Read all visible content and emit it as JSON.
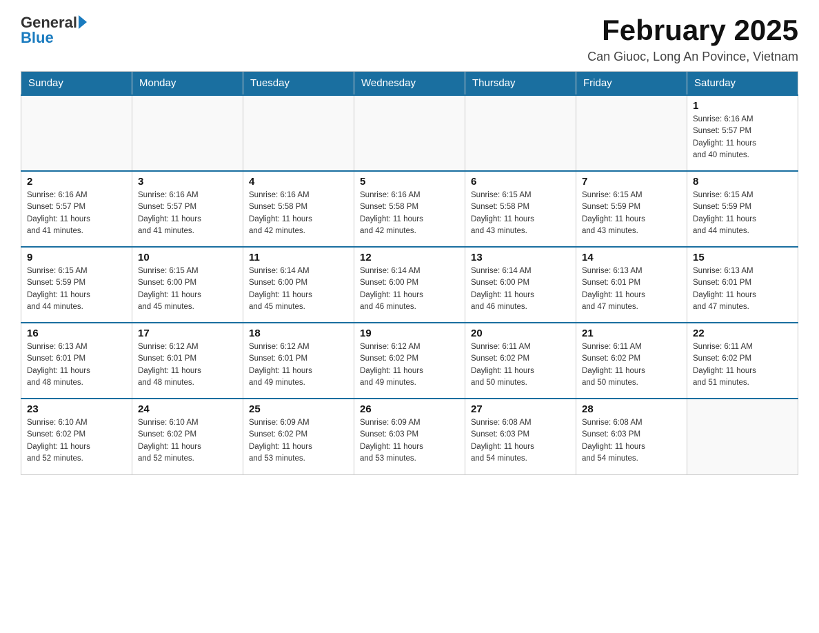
{
  "logo": {
    "general": "General",
    "blue": "Blue"
  },
  "title": "February 2025",
  "subtitle": "Can Giuoc, Long An Povince, Vietnam",
  "days_of_week": [
    "Sunday",
    "Monday",
    "Tuesday",
    "Wednesday",
    "Thursday",
    "Friday",
    "Saturday"
  ],
  "weeks": [
    [
      {
        "day": "",
        "info": ""
      },
      {
        "day": "",
        "info": ""
      },
      {
        "day": "",
        "info": ""
      },
      {
        "day": "",
        "info": ""
      },
      {
        "day": "",
        "info": ""
      },
      {
        "day": "",
        "info": ""
      },
      {
        "day": "1",
        "info": "Sunrise: 6:16 AM\nSunset: 5:57 PM\nDaylight: 11 hours\nand 40 minutes."
      }
    ],
    [
      {
        "day": "2",
        "info": "Sunrise: 6:16 AM\nSunset: 5:57 PM\nDaylight: 11 hours\nand 41 minutes."
      },
      {
        "day": "3",
        "info": "Sunrise: 6:16 AM\nSunset: 5:57 PM\nDaylight: 11 hours\nand 41 minutes."
      },
      {
        "day": "4",
        "info": "Sunrise: 6:16 AM\nSunset: 5:58 PM\nDaylight: 11 hours\nand 42 minutes."
      },
      {
        "day": "5",
        "info": "Sunrise: 6:16 AM\nSunset: 5:58 PM\nDaylight: 11 hours\nand 42 minutes."
      },
      {
        "day": "6",
        "info": "Sunrise: 6:15 AM\nSunset: 5:58 PM\nDaylight: 11 hours\nand 43 minutes."
      },
      {
        "day": "7",
        "info": "Sunrise: 6:15 AM\nSunset: 5:59 PM\nDaylight: 11 hours\nand 43 minutes."
      },
      {
        "day": "8",
        "info": "Sunrise: 6:15 AM\nSunset: 5:59 PM\nDaylight: 11 hours\nand 44 minutes."
      }
    ],
    [
      {
        "day": "9",
        "info": "Sunrise: 6:15 AM\nSunset: 5:59 PM\nDaylight: 11 hours\nand 44 minutes."
      },
      {
        "day": "10",
        "info": "Sunrise: 6:15 AM\nSunset: 6:00 PM\nDaylight: 11 hours\nand 45 minutes."
      },
      {
        "day": "11",
        "info": "Sunrise: 6:14 AM\nSunset: 6:00 PM\nDaylight: 11 hours\nand 45 minutes."
      },
      {
        "day": "12",
        "info": "Sunrise: 6:14 AM\nSunset: 6:00 PM\nDaylight: 11 hours\nand 46 minutes."
      },
      {
        "day": "13",
        "info": "Sunrise: 6:14 AM\nSunset: 6:00 PM\nDaylight: 11 hours\nand 46 minutes."
      },
      {
        "day": "14",
        "info": "Sunrise: 6:13 AM\nSunset: 6:01 PM\nDaylight: 11 hours\nand 47 minutes."
      },
      {
        "day": "15",
        "info": "Sunrise: 6:13 AM\nSunset: 6:01 PM\nDaylight: 11 hours\nand 47 minutes."
      }
    ],
    [
      {
        "day": "16",
        "info": "Sunrise: 6:13 AM\nSunset: 6:01 PM\nDaylight: 11 hours\nand 48 minutes."
      },
      {
        "day": "17",
        "info": "Sunrise: 6:12 AM\nSunset: 6:01 PM\nDaylight: 11 hours\nand 48 minutes."
      },
      {
        "day": "18",
        "info": "Sunrise: 6:12 AM\nSunset: 6:01 PM\nDaylight: 11 hours\nand 49 minutes."
      },
      {
        "day": "19",
        "info": "Sunrise: 6:12 AM\nSunset: 6:02 PM\nDaylight: 11 hours\nand 49 minutes."
      },
      {
        "day": "20",
        "info": "Sunrise: 6:11 AM\nSunset: 6:02 PM\nDaylight: 11 hours\nand 50 minutes."
      },
      {
        "day": "21",
        "info": "Sunrise: 6:11 AM\nSunset: 6:02 PM\nDaylight: 11 hours\nand 50 minutes."
      },
      {
        "day": "22",
        "info": "Sunrise: 6:11 AM\nSunset: 6:02 PM\nDaylight: 11 hours\nand 51 minutes."
      }
    ],
    [
      {
        "day": "23",
        "info": "Sunrise: 6:10 AM\nSunset: 6:02 PM\nDaylight: 11 hours\nand 52 minutes."
      },
      {
        "day": "24",
        "info": "Sunrise: 6:10 AM\nSunset: 6:02 PM\nDaylight: 11 hours\nand 52 minutes."
      },
      {
        "day": "25",
        "info": "Sunrise: 6:09 AM\nSunset: 6:02 PM\nDaylight: 11 hours\nand 53 minutes."
      },
      {
        "day": "26",
        "info": "Sunrise: 6:09 AM\nSunset: 6:03 PM\nDaylight: 11 hours\nand 53 minutes."
      },
      {
        "day": "27",
        "info": "Sunrise: 6:08 AM\nSunset: 6:03 PM\nDaylight: 11 hours\nand 54 minutes."
      },
      {
        "day": "28",
        "info": "Sunrise: 6:08 AM\nSunset: 6:03 PM\nDaylight: 11 hours\nand 54 minutes."
      },
      {
        "day": "",
        "info": ""
      }
    ]
  ]
}
